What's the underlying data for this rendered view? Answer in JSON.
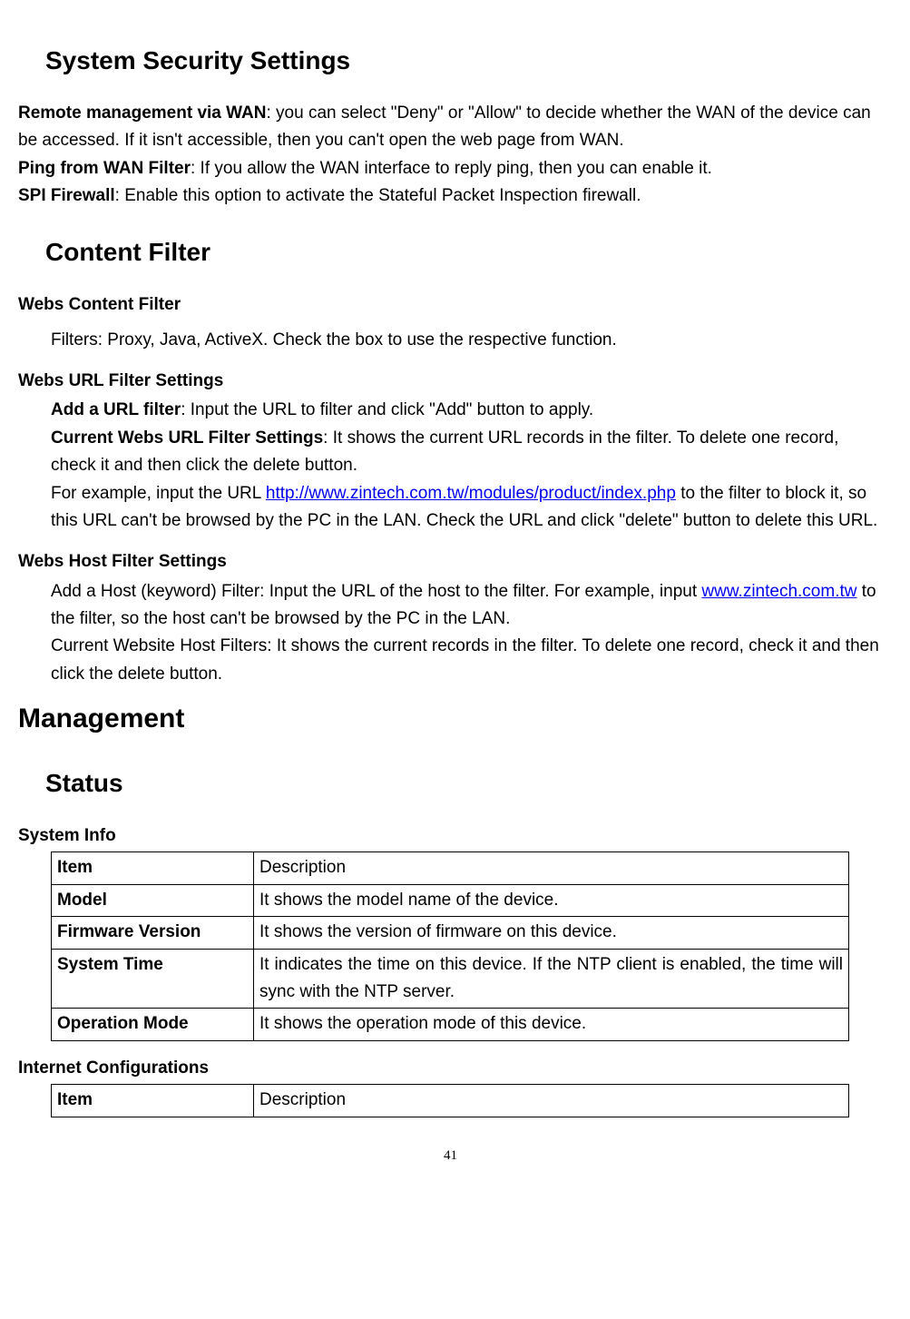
{
  "h_security": "System Security Settings",
  "p1": {
    "b1": "Remote management via WAN",
    "t1": ": you can select \"Deny\" or \"Allow\" to decide whether the WAN of the device can be accessed. If it isn't accessible, then you can't open the web page from WAN.",
    "b2": "Ping from WAN Filter",
    "t2": ": If you allow the WAN interface to reply ping, then you can enable it.",
    "b3": "SPI Firewall",
    "t3": ": Enable this option to activate the Stateful Packet Inspection firewall."
  },
  "h_content": "Content Filter",
  "wcf": {
    "h": "Webs Content Filter",
    "t": "Filters: Proxy, Java, ActiveX. Check the box to use the respective function."
  },
  "wurl": {
    "h": "Webs URL Filter Settings",
    "b1": "Add a URL filter",
    "t1": ": Input the URL to filter and click \"Add\" button to apply.",
    "b2": "Current Webs URL Filter Settings",
    "t2": ": It shows the current URL records in the filter. To delete one record, check it and then click the delete button.",
    "t3a": "For example, input the URL ",
    "link1": "http://www.zintech.com.tw/modules/product/index.php",
    "t3b": " to the filter to block it, so this URL can't be browsed by the PC in the LAN. Check the URL and click \"delete\" button to delete this URL."
  },
  "whost": {
    "h": "Webs Host Filter Settings",
    "t1a": "Add a Host (keyword) Filter: Input the URL of the host to the filter. For example, input ",
    "link1": "www.zintech.com.tw",
    "t1b": " to the filter, so the host can't be browsed by the PC in the LAN.",
    "t2": "Current Website Host Filters: It shows the current records in the filter. To delete one record, check it and then click the delete button."
  },
  "h_mgmt": "Management",
  "h_status": "Status",
  "sysinfo": {
    "h": "System Info",
    "r0c0": "Item",
    "r0c1": "Description",
    "r1c0": "Model",
    "r1c1": "It shows the model name of the device.",
    "r2c0": "Firmware Version",
    "r2c1": "It shows the version of firmware on this device.",
    "r3c0": "System Time",
    "r3c1": "It indicates the time on this device. If the NTP client is enabled, the time will sync with the NTP server.",
    "r4c0": "Operation Mode",
    "r4c1": "It shows the operation mode of this device."
  },
  "inetcfg": {
    "h": "Internet Configurations",
    "r0c0": "Item",
    "r0c1": "Description"
  },
  "page": "41"
}
